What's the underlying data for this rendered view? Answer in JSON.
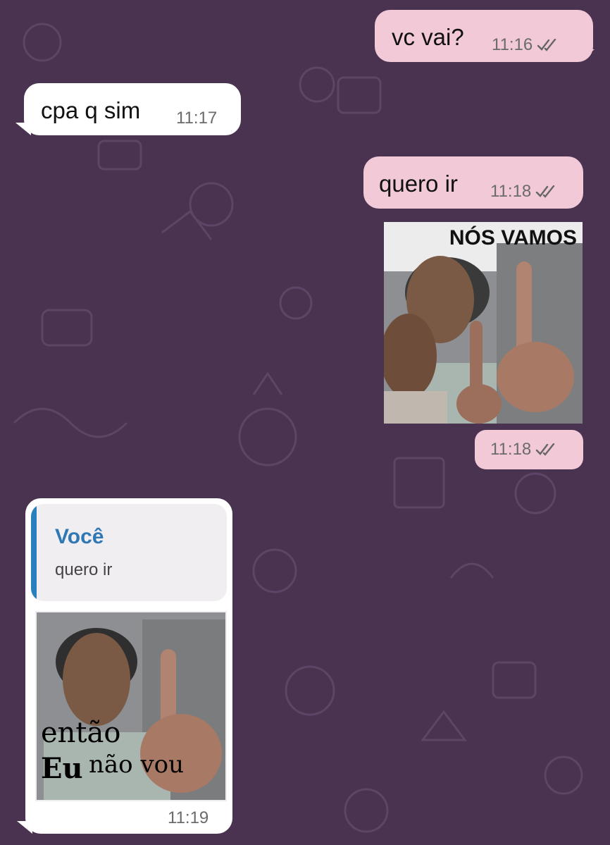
{
  "chat": {
    "messages": [
      {
        "direction": "outgoing",
        "text": "vc vai?",
        "time": "11:16",
        "status": "read-double-check"
      },
      {
        "direction": "incoming",
        "text": "cpa q sim",
        "time": "11:17"
      },
      {
        "direction": "outgoing",
        "text": "quero ir",
        "time": "11:18",
        "status": "read-double-check"
      },
      {
        "direction": "outgoing",
        "type": "sticker",
        "caption": "NÓS VAMOS",
        "time": "11:18",
        "status": "read-double-check"
      },
      {
        "direction": "incoming",
        "type": "sticker-reply",
        "quote": {
          "author": "Você",
          "text": "quero ir"
        },
        "caption_line1": "então",
        "caption_line2_bold": "Eu",
        "caption_line2": "não vou",
        "time": "11:19"
      }
    ]
  },
  "icons": {
    "read_receipt": "double-check-icon"
  },
  "colors": {
    "background": "#4a3350",
    "outgoing_bubble": "#f2c9d6",
    "incoming_bubble": "#ffffff",
    "quote_accent": "#2a7fbd"
  }
}
